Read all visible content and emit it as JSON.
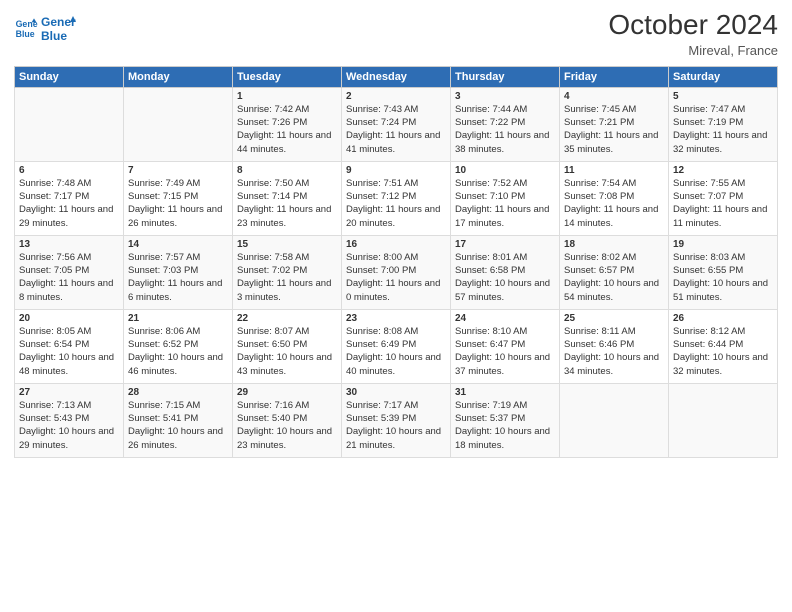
{
  "header": {
    "logo_line1": "General",
    "logo_line2": "Blue",
    "main_title": "October 2024",
    "subtitle": "Mireval, France"
  },
  "days_of_week": [
    "Sunday",
    "Monday",
    "Tuesday",
    "Wednesday",
    "Thursday",
    "Friday",
    "Saturday"
  ],
  "weeks": [
    [
      {
        "day": "",
        "sunrise": "",
        "sunset": "",
        "daylight": ""
      },
      {
        "day": "",
        "sunrise": "",
        "sunset": "",
        "daylight": ""
      },
      {
        "day": "1",
        "sunrise": "Sunrise: 7:42 AM",
        "sunset": "Sunset: 7:26 PM",
        "daylight": "Daylight: 11 hours and 44 minutes."
      },
      {
        "day": "2",
        "sunrise": "Sunrise: 7:43 AM",
        "sunset": "Sunset: 7:24 PM",
        "daylight": "Daylight: 11 hours and 41 minutes."
      },
      {
        "day": "3",
        "sunrise": "Sunrise: 7:44 AM",
        "sunset": "Sunset: 7:22 PM",
        "daylight": "Daylight: 11 hours and 38 minutes."
      },
      {
        "day": "4",
        "sunrise": "Sunrise: 7:45 AM",
        "sunset": "Sunset: 7:21 PM",
        "daylight": "Daylight: 11 hours and 35 minutes."
      },
      {
        "day": "5",
        "sunrise": "Sunrise: 7:47 AM",
        "sunset": "Sunset: 7:19 PM",
        "daylight": "Daylight: 11 hours and 32 minutes."
      }
    ],
    [
      {
        "day": "6",
        "sunrise": "Sunrise: 7:48 AM",
        "sunset": "Sunset: 7:17 PM",
        "daylight": "Daylight: 11 hours and 29 minutes."
      },
      {
        "day": "7",
        "sunrise": "Sunrise: 7:49 AM",
        "sunset": "Sunset: 7:15 PM",
        "daylight": "Daylight: 11 hours and 26 minutes."
      },
      {
        "day": "8",
        "sunrise": "Sunrise: 7:50 AM",
        "sunset": "Sunset: 7:14 PM",
        "daylight": "Daylight: 11 hours and 23 minutes."
      },
      {
        "day": "9",
        "sunrise": "Sunrise: 7:51 AM",
        "sunset": "Sunset: 7:12 PM",
        "daylight": "Daylight: 11 hours and 20 minutes."
      },
      {
        "day": "10",
        "sunrise": "Sunrise: 7:52 AM",
        "sunset": "Sunset: 7:10 PM",
        "daylight": "Daylight: 11 hours and 17 minutes."
      },
      {
        "day": "11",
        "sunrise": "Sunrise: 7:54 AM",
        "sunset": "Sunset: 7:08 PM",
        "daylight": "Daylight: 11 hours and 14 minutes."
      },
      {
        "day": "12",
        "sunrise": "Sunrise: 7:55 AM",
        "sunset": "Sunset: 7:07 PM",
        "daylight": "Daylight: 11 hours and 11 minutes."
      }
    ],
    [
      {
        "day": "13",
        "sunrise": "Sunrise: 7:56 AM",
        "sunset": "Sunset: 7:05 PM",
        "daylight": "Daylight: 11 hours and 8 minutes."
      },
      {
        "day": "14",
        "sunrise": "Sunrise: 7:57 AM",
        "sunset": "Sunset: 7:03 PM",
        "daylight": "Daylight: 11 hours and 6 minutes."
      },
      {
        "day": "15",
        "sunrise": "Sunrise: 7:58 AM",
        "sunset": "Sunset: 7:02 PM",
        "daylight": "Daylight: 11 hours and 3 minutes."
      },
      {
        "day": "16",
        "sunrise": "Sunrise: 8:00 AM",
        "sunset": "Sunset: 7:00 PM",
        "daylight": "Daylight: 11 hours and 0 minutes."
      },
      {
        "day": "17",
        "sunrise": "Sunrise: 8:01 AM",
        "sunset": "Sunset: 6:58 PM",
        "daylight": "Daylight: 10 hours and 57 minutes."
      },
      {
        "day": "18",
        "sunrise": "Sunrise: 8:02 AM",
        "sunset": "Sunset: 6:57 PM",
        "daylight": "Daylight: 10 hours and 54 minutes."
      },
      {
        "day": "19",
        "sunrise": "Sunrise: 8:03 AM",
        "sunset": "Sunset: 6:55 PM",
        "daylight": "Daylight: 10 hours and 51 minutes."
      }
    ],
    [
      {
        "day": "20",
        "sunrise": "Sunrise: 8:05 AM",
        "sunset": "Sunset: 6:54 PM",
        "daylight": "Daylight: 10 hours and 48 minutes."
      },
      {
        "day": "21",
        "sunrise": "Sunrise: 8:06 AM",
        "sunset": "Sunset: 6:52 PM",
        "daylight": "Daylight: 10 hours and 46 minutes."
      },
      {
        "day": "22",
        "sunrise": "Sunrise: 8:07 AM",
        "sunset": "Sunset: 6:50 PM",
        "daylight": "Daylight: 10 hours and 43 minutes."
      },
      {
        "day": "23",
        "sunrise": "Sunrise: 8:08 AM",
        "sunset": "Sunset: 6:49 PM",
        "daylight": "Daylight: 10 hours and 40 minutes."
      },
      {
        "day": "24",
        "sunrise": "Sunrise: 8:10 AM",
        "sunset": "Sunset: 6:47 PM",
        "daylight": "Daylight: 10 hours and 37 minutes."
      },
      {
        "day": "25",
        "sunrise": "Sunrise: 8:11 AM",
        "sunset": "Sunset: 6:46 PM",
        "daylight": "Daylight: 10 hours and 34 minutes."
      },
      {
        "day": "26",
        "sunrise": "Sunrise: 8:12 AM",
        "sunset": "Sunset: 6:44 PM",
        "daylight": "Daylight: 10 hours and 32 minutes."
      }
    ],
    [
      {
        "day": "27",
        "sunrise": "Sunrise: 7:13 AM",
        "sunset": "Sunset: 5:43 PM",
        "daylight": "Daylight: 10 hours and 29 minutes."
      },
      {
        "day": "28",
        "sunrise": "Sunrise: 7:15 AM",
        "sunset": "Sunset: 5:41 PM",
        "daylight": "Daylight: 10 hours and 26 minutes."
      },
      {
        "day": "29",
        "sunrise": "Sunrise: 7:16 AM",
        "sunset": "Sunset: 5:40 PM",
        "daylight": "Daylight: 10 hours and 23 minutes."
      },
      {
        "day": "30",
        "sunrise": "Sunrise: 7:17 AM",
        "sunset": "Sunset: 5:39 PM",
        "daylight": "Daylight: 10 hours and 21 minutes."
      },
      {
        "day": "31",
        "sunrise": "Sunrise: 7:19 AM",
        "sunset": "Sunset: 5:37 PM",
        "daylight": "Daylight: 10 hours and 18 minutes."
      },
      {
        "day": "",
        "sunrise": "",
        "sunset": "",
        "daylight": ""
      },
      {
        "day": "",
        "sunrise": "",
        "sunset": "",
        "daylight": ""
      }
    ]
  ]
}
